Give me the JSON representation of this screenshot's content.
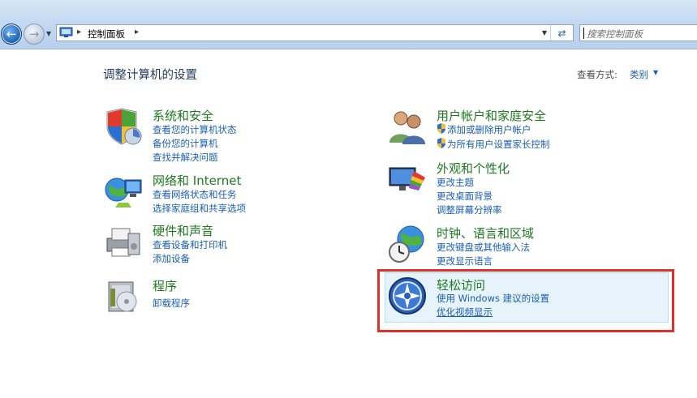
{
  "addressbar": {
    "crumb": "控制面板",
    "search_placeholder": "搜索控制面板"
  },
  "main": {
    "title": "调整计算机的设置",
    "view_by_label": "查看方式:",
    "view_by_value": "类别"
  },
  "left": [
    {
      "title": "系统和安全",
      "icon": "shield-globe-icon",
      "links": [
        "查看您的计算机状态",
        "备份您的计算机",
        "查找并解决问题"
      ]
    },
    {
      "title": "网络和 Internet",
      "icon": "network-globe-icon",
      "links": [
        "查看网络状态和任务",
        "选择家庭组和共享选项"
      ]
    },
    {
      "title": "硬件和声音",
      "icon": "printer-icon",
      "links": [
        "查看设备和打印机",
        "添加设备"
      ]
    },
    {
      "title": "程序",
      "icon": "programs-box-icon",
      "links": [
        "卸载程序"
      ]
    }
  ],
  "right": [
    {
      "title": "用户帐户和家庭安全",
      "icon": "users-icon",
      "links": [
        "添加或删除用户帐户",
        "为所有用户设置家长控制"
      ]
    },
    {
      "title": "外观和个性化",
      "icon": "monitor-colors-icon",
      "links": [
        "更改主题",
        "更改桌面背景",
        "调整屏幕分辨率"
      ]
    },
    {
      "title": "时钟、语言和区域",
      "icon": "clock-globe-icon",
      "links": [
        "更改键盘或其他输入法",
        "更改显示语言"
      ]
    },
    {
      "title": "轻松访问",
      "icon": "ease-of-access-icon",
      "links": [
        "使用 Windows 建议的设置",
        "优化视频显示"
      ]
    }
  ],
  "colors": {
    "title_green": "#1e7a1e",
    "link_blue": "#1a5fb4",
    "highlight_border": "#e0302a"
  }
}
